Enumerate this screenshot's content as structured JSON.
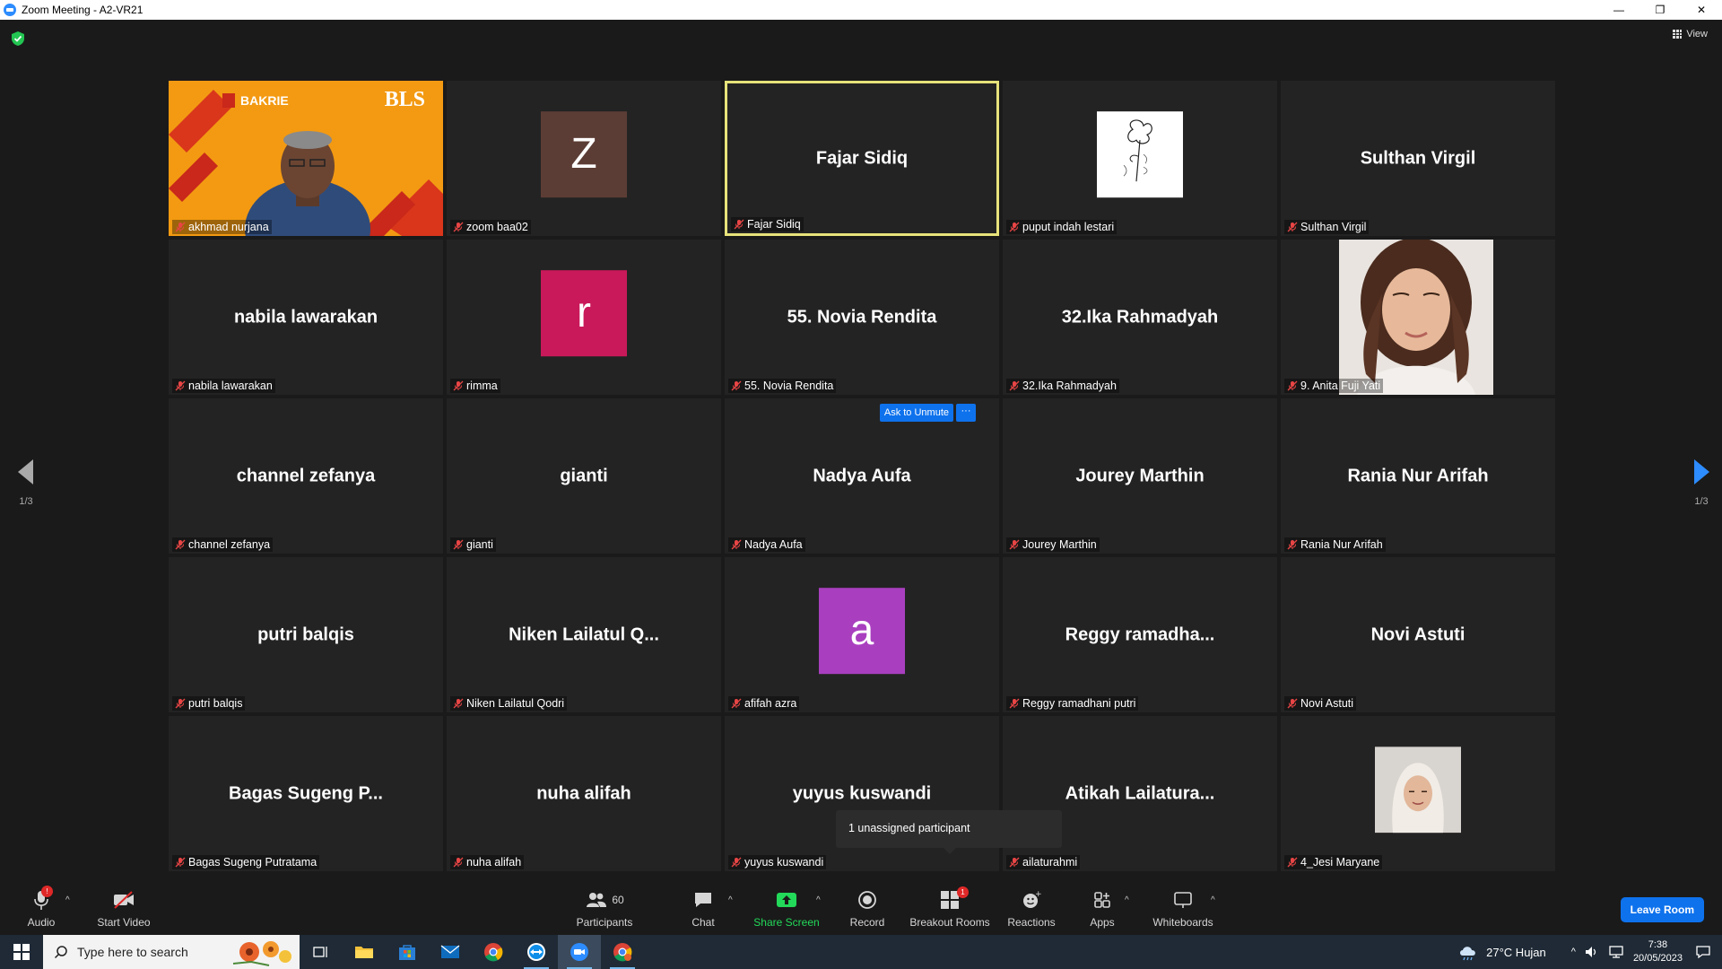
{
  "window": {
    "title": "Zoom Meeting - A2-VR21",
    "minimize": "—",
    "restore": "❐",
    "close": "✕"
  },
  "view_button": {
    "label": "View"
  },
  "pager": {
    "left": "1/3",
    "right": "1/3"
  },
  "tiles": [
    {
      "display": "",
      "label": "akhmad nurjana",
      "kind": "video"
    },
    {
      "display": "",
      "label": "zoom baa02",
      "kind": "avatar",
      "letter": "Z",
      "color": "#5c3d35"
    },
    {
      "display": "Fajar Sidiq",
      "label": "Fajar Sidiq",
      "kind": "name",
      "active": true
    },
    {
      "display": "",
      "label": "puput indah lestari",
      "kind": "sketch"
    },
    {
      "display": "Sulthan Virgil",
      "label": "Sulthan Virgil",
      "kind": "name"
    },
    {
      "display": "nabila lawarakan",
      "label": "nabila lawarakan",
      "kind": "name"
    },
    {
      "display": "",
      "label": "rimma",
      "kind": "avatar",
      "letter": "r",
      "color": "#c9195a"
    },
    {
      "display": "55. Novia Rendita",
      "label": "55. Novia Rendita",
      "kind": "name"
    },
    {
      "display": "32.Ika Rahmadyah",
      "label": "32.Ika Rahmadyah",
      "kind": "name"
    },
    {
      "display": "",
      "label": "9. Anita Fuji Yati",
      "kind": "photo"
    },
    {
      "display": "channel zefanya",
      "label": "channel zefanya",
      "kind": "name"
    },
    {
      "display": "gianti",
      "label": "gianti",
      "kind": "name"
    },
    {
      "display": "Nadya Aufa",
      "label": "Nadya Aufa",
      "kind": "name",
      "ask_unmute": true
    },
    {
      "display": "Jourey Marthin",
      "label": "Jourey Marthin",
      "kind": "name"
    },
    {
      "display": "Rania Nur Arifah",
      "label": "Rania Nur Arifah",
      "kind": "name"
    },
    {
      "display": "putri balqis",
      "label": "putri balqis",
      "kind": "name"
    },
    {
      "display": "Niken  Lailatul  Q...",
      "label": "Niken Lailatul Qodri",
      "kind": "name"
    },
    {
      "display": "",
      "label": "afifah azra",
      "kind": "avatar",
      "letter": "a",
      "color": "#a93fbf"
    },
    {
      "display": "Reggy  ramadha...",
      "label": "Reggy ramadhani putri",
      "kind": "name"
    },
    {
      "display": "Novi Astuti",
      "label": "Novi Astuti",
      "kind": "name"
    },
    {
      "display": "Bagas Sugeng  P...",
      "label": "Bagas Sugeng Putratama",
      "kind": "name"
    },
    {
      "display": "nuha alifah",
      "label": "nuha alifah",
      "kind": "name"
    },
    {
      "display": "yuyus kuswandi",
      "label": "yuyus kuswandi",
      "kind": "name"
    },
    {
      "display": "Atikah  Lailatura...",
      "label": "ailaturahmi",
      "kind": "name"
    },
    {
      "display": "",
      "label": "4_Jesi Maryane",
      "kind": "photo2"
    }
  ],
  "ask_unmute": {
    "label": "Ask to Unmute",
    "more": "···"
  },
  "tooltip": {
    "text": "1 unassigned participant"
  },
  "toolbar": {
    "audio": "Audio",
    "audio_badge": "!",
    "start_video": "Start Video",
    "participants": "Participants",
    "participants_count": "60",
    "chat": "Chat",
    "share_screen": "Share Screen",
    "record": "Record",
    "breakout_rooms": "Breakout Rooms",
    "breakout_badge": "1",
    "reactions": "Reactions",
    "apps": "Apps",
    "whiteboards": "Whiteboards",
    "leave": "Leave Room"
  },
  "taskbar": {
    "search_placeholder": "Type here to search",
    "weather": "27°C  Hujan",
    "time": "7:38",
    "date": "20/05/2023"
  },
  "video_tile": {
    "logo_left": "BAKRIE",
    "logo_right": "BLS"
  },
  "colors": {
    "accent": "#0e72ed",
    "active_border": "#e6e27a",
    "share_green": "#23d959",
    "mute_red": "#e02828"
  }
}
